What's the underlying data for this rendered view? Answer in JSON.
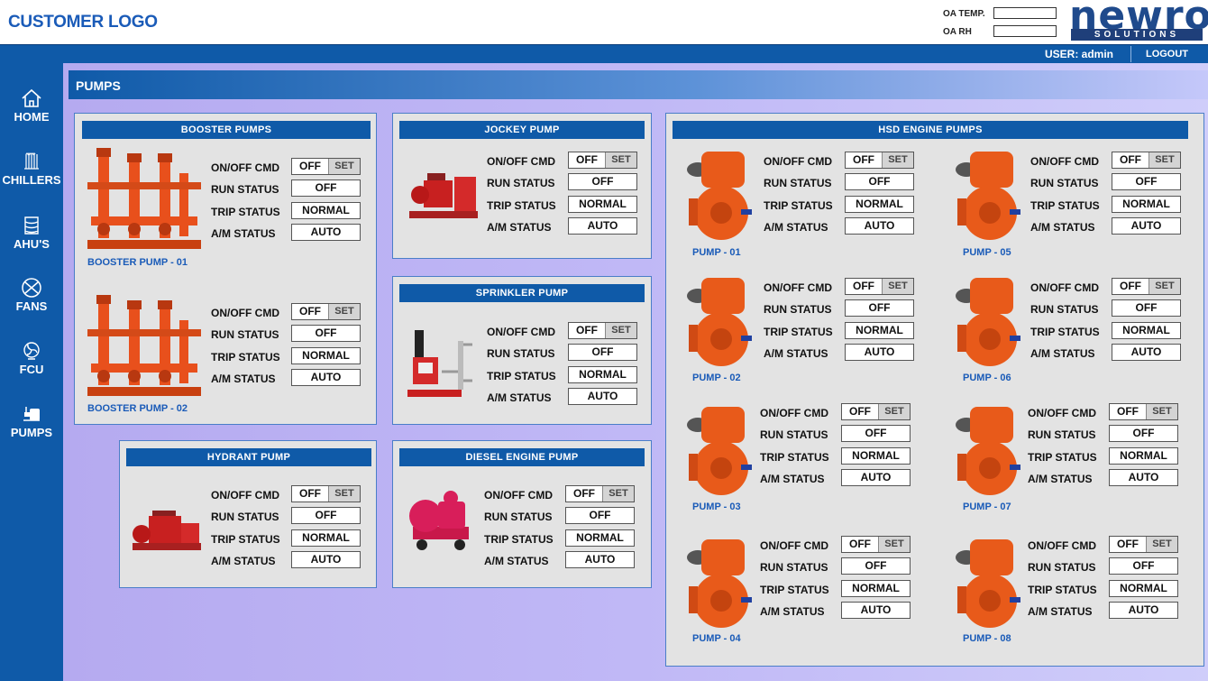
{
  "header": {
    "customer_logo": "CUSTOMER LOGO",
    "oa_temp_label": "OA TEMP.",
    "oa_rh_label": "OA RH",
    "brand_word": "newron",
    "brand_sub": "SOLUTIONS"
  },
  "topbar": {
    "user": "USER: admin",
    "logout": "LOGOUT"
  },
  "nav": [
    "HOME",
    "CHILLERS",
    "AHU'S",
    "FANS",
    "FCU",
    "PUMPS"
  ],
  "page": {
    "title": "PUMPS"
  },
  "labels": {
    "cmd": "ON/OFF CMD",
    "run": "RUN STATUS",
    "trip": "TRIP STATUS",
    "am": "A/M STATUS"
  },
  "common": {
    "off": "OFF",
    "set": "SET"
  },
  "panels": {
    "booster": {
      "title": "BOOSTER PUMPS"
    },
    "jockey": {
      "title": "JOCKEY PUMP"
    },
    "sprinkler": {
      "title": "SPRINKLER PUMP"
    },
    "hydrant": {
      "title": "HYDRANT PUMP"
    },
    "diesel": {
      "title": "DIESEL ENGINE PUMP"
    },
    "hsd": {
      "title": "HSD ENGINE PUMPS"
    }
  },
  "pumps": {
    "booster_01": {
      "name": "BOOSTER PUMP - 01",
      "cmd": "OFF",
      "run": "OFF",
      "trip": "NORMAL",
      "am": "AUTO"
    },
    "booster_02": {
      "name": "BOOSTER PUMP - 02",
      "cmd": "OFF",
      "run": "OFF",
      "trip": "NORMAL",
      "am": "AUTO"
    },
    "jockey": {
      "cmd": "OFF",
      "run": "OFF",
      "trip": "NORMAL",
      "am": "AUTO"
    },
    "sprinkler": {
      "cmd": "OFF",
      "run": "OFF",
      "trip": "NORMAL",
      "am": "AUTO"
    },
    "hydrant": {
      "cmd": "OFF",
      "run": "OFF",
      "trip": "NORMAL",
      "am": "AUTO"
    },
    "diesel": {
      "cmd": "OFF",
      "run": "OFF",
      "trip": "NORMAL",
      "am": "AUTO"
    },
    "hsd_01": {
      "name": "PUMP - 01",
      "cmd": "OFF",
      "run": "OFF",
      "trip": "NORMAL",
      "am": "AUTO"
    },
    "hsd_02": {
      "name": "PUMP - 02",
      "cmd": "OFF",
      "run": "OFF",
      "trip": "NORMAL",
      "am": "AUTO"
    },
    "hsd_03": {
      "name": "PUMP - 03",
      "cmd": "OFF",
      "run": "OFF",
      "trip": "NORMAL",
      "am": "AUTO"
    },
    "hsd_04": {
      "name": "PUMP - 04",
      "cmd": "OFF",
      "run": "OFF",
      "trip": "NORMAL",
      "am": "AUTO"
    },
    "hsd_05": {
      "name": "PUMP - 05",
      "cmd": "OFF",
      "run": "OFF",
      "trip": "NORMAL",
      "am": "AUTO"
    },
    "hsd_06": {
      "name": "PUMP - 06",
      "cmd": "OFF",
      "run": "OFF",
      "trip": "NORMAL",
      "am": "AUTO"
    },
    "hsd_07": {
      "name": "PUMP - 07",
      "cmd": "OFF",
      "run": "OFF",
      "trip": "NORMAL",
      "am": "AUTO"
    },
    "hsd_08": {
      "name": "PUMP - 08",
      "cmd": "OFF",
      "run": "OFF",
      "trip": "NORMAL",
      "am": "AUTO"
    }
  },
  "colors": {
    "accent": "#0f5aa8",
    "pump_orange": "#e8501c",
    "name_blue": "#1a5bb8"
  }
}
